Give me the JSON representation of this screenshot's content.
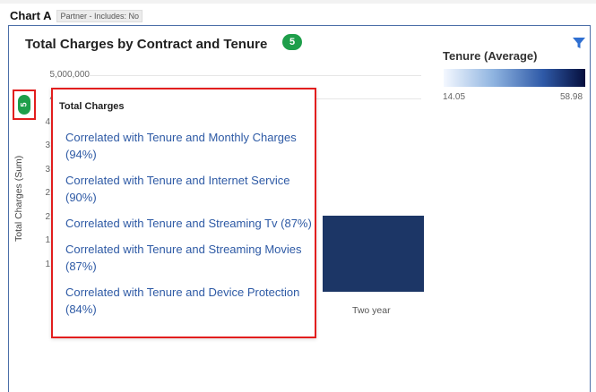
{
  "header": {
    "chart_name": "Chart A",
    "partner_tag": "Partner - Includes: No"
  },
  "card": {
    "title": "Total Charges by Contract and Tenure",
    "count_badge": "5"
  },
  "icons": {
    "filter": "filter-icon"
  },
  "colors": {
    "accent": "#4c6fa8",
    "badge_green": "#1e9e4a",
    "highlight_red": "#e21e1e",
    "bar_navy": "#1c3666",
    "link_blue": "#2e5aa5"
  },
  "chart_data": {
    "type": "bar",
    "ylabel": "Total Charges (Sum)",
    "y_ticks": [
      "5,000,000",
      "4,500,000",
      "4",
      "3",
      "3",
      "2",
      "2",
      "1",
      "1"
    ],
    "categories": [
      "Two year"
    ],
    "legend": {
      "title": "Tenure (Average)",
      "min": "14.05",
      "max": "58.98"
    }
  },
  "side_badge": "5",
  "tooltip": {
    "heading": "Total Charges",
    "items": [
      "Correlated with Tenure and Monthly Charges (94%)",
      "Correlated with Tenure and Internet Service (90%)",
      "Correlated with Tenure and Streaming Tv (87%)",
      "Correlated with Tenure and Streaming Movies (87%)",
      "Correlated with Tenure and Device Protection (84%)"
    ]
  }
}
